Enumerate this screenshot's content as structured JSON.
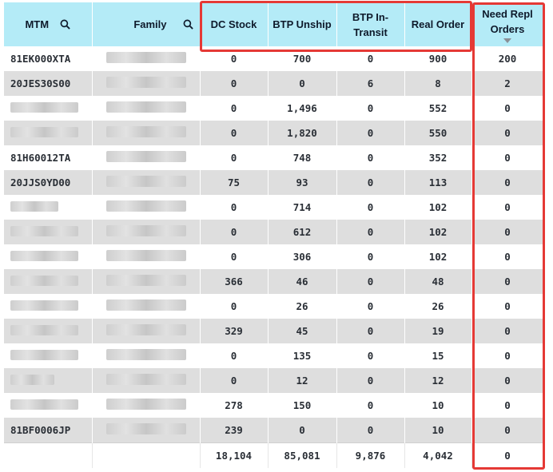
{
  "columns": [
    {
      "label": "MTM",
      "icon": "search-icon"
    },
    {
      "label": "Family",
      "icon": "search-icon"
    },
    {
      "label": "DC Stock"
    },
    {
      "label": "BTP Unship"
    },
    {
      "label": "BTP In-\nTransit"
    },
    {
      "label": "Real Order"
    },
    {
      "label": "Need Repl\nOrders",
      "sort": "descending"
    }
  ],
  "rows": [
    {
      "mtm": "81EK000XTA",
      "dc": "0",
      "unship": "700",
      "transit": "0",
      "real": "900",
      "need": "200"
    },
    {
      "mtm": "20JES30S00",
      "dc": "0",
      "unship": "0",
      "transit": "6",
      "real": "8",
      "need": "2"
    },
    {
      "mtm": "",
      "dc": "0",
      "unship": "1,496",
      "transit": "0",
      "real": "552",
      "need": "0"
    },
    {
      "mtm": "",
      "dc": "0",
      "unship": "1,820",
      "transit": "0",
      "real": "550",
      "need": "0"
    },
    {
      "mtm": "81H60012TA",
      "dc": "0",
      "unship": "748",
      "transit": "0",
      "real": "352",
      "need": "0"
    },
    {
      "mtm": "20JJS0YD00",
      "dc": "75",
      "unship": "93",
      "transit": "0",
      "real": "113",
      "need": "0"
    },
    {
      "mtm": "",
      "dc": "0",
      "unship": "714",
      "transit": "0",
      "real": "102",
      "need": "0"
    },
    {
      "mtm": "",
      "dc": "0",
      "unship": "612",
      "transit": "0",
      "real": "102",
      "need": "0"
    },
    {
      "mtm": "",
      "dc": "0",
      "unship": "306",
      "transit": "0",
      "real": "102",
      "need": "0"
    },
    {
      "mtm": "",
      "dc": "366",
      "unship": "46",
      "transit": "0",
      "real": "48",
      "need": "0"
    },
    {
      "mtm": "",
      "dc": "0",
      "unship": "26",
      "transit": "0",
      "real": "26",
      "need": "0"
    },
    {
      "mtm": "",
      "dc": "329",
      "unship": "45",
      "transit": "0",
      "real": "19",
      "need": "0"
    },
    {
      "mtm": "",
      "dc": "0",
      "unship": "135",
      "transit": "0",
      "real": "15",
      "need": "0"
    },
    {
      "mtm": "",
      "dc": "0",
      "unship": "12",
      "transit": "0",
      "real": "12",
      "need": "0"
    },
    {
      "mtm": "",
      "dc": "278",
      "unship": "150",
      "transit": "0",
      "real": "10",
      "need": "0"
    },
    {
      "mtm": "81BF0006JP",
      "dc": "239",
      "unship": "0",
      "transit": "0",
      "real": "10",
      "need": "0"
    }
  ],
  "totals": {
    "dc": "18,104",
    "unship": "85,081",
    "transit": "9,876",
    "real": "4,042",
    "need": "0"
  },
  "colors": {
    "header_bg": "#b4ebf7",
    "stripe": "#dedede",
    "highlight": "#e53935"
  }
}
